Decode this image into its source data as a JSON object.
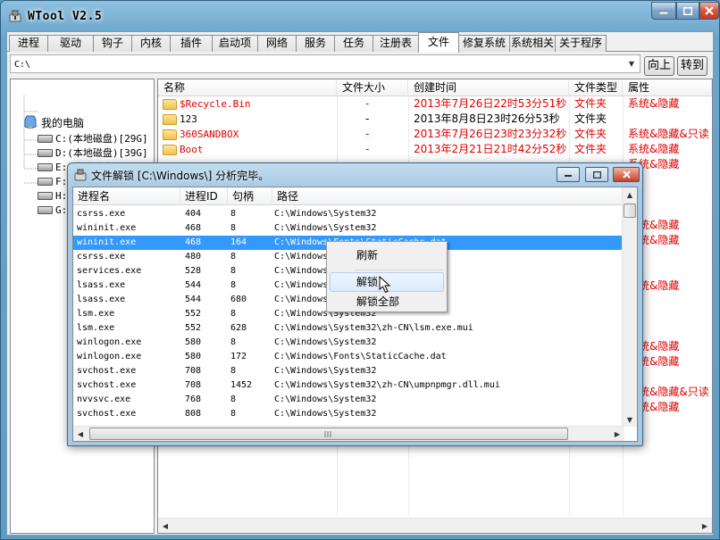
{
  "window": {
    "title": "WTool V2.5"
  },
  "tabs": [
    "进程",
    "驱动",
    "钩子",
    "内核",
    "插件",
    "启动项",
    "网络",
    "服务",
    "任务",
    "注册表",
    "文件",
    "修复系统",
    "系统相关",
    "关于程序"
  ],
  "active_tab": "文件",
  "address": {
    "value": "C:\\",
    "up_label": "向上",
    "goto_label": "转到"
  },
  "tree": {
    "root": "我的电脑",
    "drives": [
      "C:(本地磁盘)[29G]",
      "D:(本地磁盘)[39G]",
      "E:(本地磁盘)[117G]",
      "F:(本地磁盘)[113G]",
      "H:(可移动磁盘)[7G]",
      "G:(本地磁盘)[..."
    ]
  },
  "file_list": {
    "columns": [
      "名称",
      "文件大小",
      "创建时间",
      "文件类型",
      "属性"
    ],
    "rows": [
      {
        "name": "$Recycle.Bin",
        "size": "-",
        "created": "2013年7月26日22时53分51秒",
        "type": "文件夹",
        "attr": "系统&隐藏",
        "red": true
      },
      {
        "name": "123",
        "size": "-",
        "created": "2013年8月8日23时26分53秒",
        "type": "文件夹",
        "attr": "",
        "red": false
      },
      {
        "name": "360SANDBOX",
        "size": "-",
        "created": "2013年7月26日23时23分32秒",
        "type": "文件夹",
        "attr": "系统&隐藏&只读",
        "red": true
      },
      {
        "name": "Boot",
        "size": "-",
        "created": "2013年2月21日21时42分52秒",
        "type": "文件夹",
        "attr": "系统&隐藏",
        "red": true
      },
      {
        "name": "",
        "size": "",
        "created": "",
        "type": "",
        "attr": "系统&隐藏",
        "red": true
      },
      {
        "name": "",
        "size": "",
        "created": "",
        "type": "",
        "attr": "",
        "red": false
      },
      {
        "name": "",
        "size": "",
        "created": "",
        "type": "",
        "attr": "",
        "red": false
      },
      {
        "name": "",
        "size": "",
        "created": "",
        "type": "",
        "attr": "",
        "red": false
      },
      {
        "name": "",
        "size": "",
        "created": "",
        "type": "",
        "attr": "系统&隐藏",
        "red": true
      },
      {
        "name": "",
        "size": "",
        "created": "",
        "type": "",
        "attr": "系统&隐藏",
        "red": true
      },
      {
        "name": "",
        "size": "",
        "created": "",
        "type": "",
        "attr": "",
        "red": false
      },
      {
        "name": "",
        "size": "",
        "created": "",
        "type": "",
        "attr": "",
        "red": false
      },
      {
        "name": "",
        "size": "",
        "created": "",
        "type": "",
        "attr": "系统&隐藏",
        "red": true
      },
      {
        "name": "",
        "size": "",
        "created": "",
        "type": "",
        "attr": "",
        "red": false
      },
      {
        "name": "",
        "size": "",
        "created": "",
        "type": "",
        "attr": "",
        "red": false
      },
      {
        "name": "",
        "size": "",
        "created": "",
        "type": "",
        "attr": "",
        "red": false
      },
      {
        "name": "",
        "size": "",
        "created": "",
        "type": "",
        "attr": "系统&隐藏",
        "red": true
      },
      {
        "name": "",
        "size": "",
        "created": "",
        "type": "",
        "attr": "系统&隐藏",
        "red": true
      },
      {
        "name": "",
        "size": "",
        "created": "",
        "type": "",
        "attr": "",
        "red": false
      },
      {
        "name": "",
        "size": "",
        "created": "",
        "type": "",
        "attr": "系统&隐藏&只读",
        "red": true
      },
      {
        "name": "",
        "size": "",
        "created": "",
        "type": "",
        "attr": "系统&隐藏",
        "red": true
      }
    ]
  },
  "dialog": {
    "title": "文件解锁 [C:\\Windows\\] 分析完毕。",
    "columns": [
      "进程名",
      "进程ID",
      "句柄",
      "路径"
    ],
    "selected_index": 2,
    "rows": [
      [
        "csrss.exe",
        "404",
        "8",
        "C:\\Windows\\System32"
      ],
      [
        "wininit.exe",
        "468",
        "8",
        "C:\\Windows\\System32"
      ],
      [
        "wininit.exe",
        "468",
        "164",
        "C:\\Windows\\Fonts\\StaticCache.dat"
      ],
      [
        "csrss.exe",
        "480",
        "8",
        "C:\\Windows\\System32"
      ],
      [
        "services.exe",
        "528",
        "8",
        "C:\\Windows\\System32"
      ],
      [
        "lsass.exe",
        "544",
        "8",
        "C:\\Windows\\System32"
      ],
      [
        "lsass.exe",
        "544",
        "680",
        "C:\\Windows\\System32"
      ],
      [
        "lsm.exe",
        "552",
        "8",
        "C:\\Windows\\System32"
      ],
      [
        "lsm.exe",
        "552",
        "628",
        "C:\\Windows\\System32\\zh-CN\\lsm.exe.mui"
      ],
      [
        "winlogon.exe",
        "580",
        "8",
        "C:\\Windows\\System32"
      ],
      [
        "winlogon.exe",
        "580",
        "172",
        "C:\\Windows\\Fonts\\StaticCache.dat"
      ],
      [
        "svchost.exe",
        "708",
        "8",
        "C:\\Windows\\System32"
      ],
      [
        "svchost.exe",
        "708",
        "1452",
        "C:\\Windows\\System32\\zh-CN\\umpnpmgr.dll.mui"
      ],
      [
        "nvvsvc.exe",
        "768",
        "8",
        "C:\\Windows\\System32"
      ],
      [
        "svchost.exe",
        "808",
        "8",
        "C:\\Windows\\System32"
      ]
    ]
  },
  "context_menu": {
    "items": [
      "刷新",
      "解锁",
      "解锁全部"
    ],
    "hover_index": 1
  },
  "colors": {
    "red_text": "#e00000",
    "selection": "#3399ff"
  }
}
